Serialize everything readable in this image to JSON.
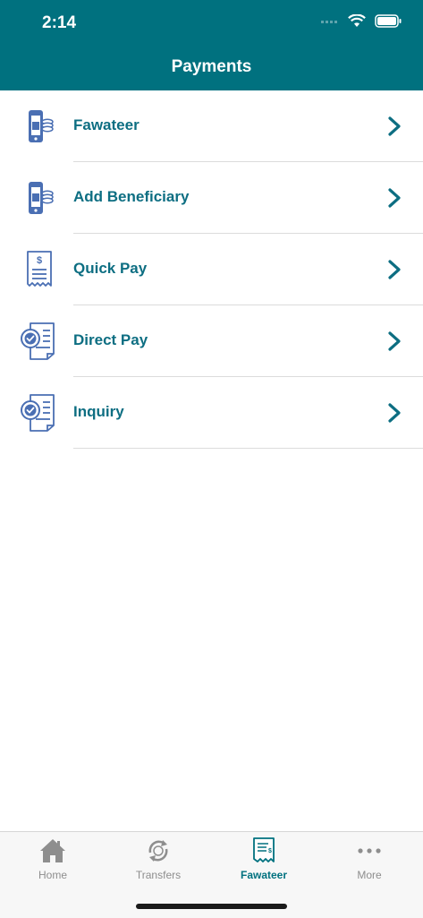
{
  "status": {
    "time": "2:14"
  },
  "header": {
    "title": "Payments"
  },
  "items": [
    {
      "label": "Fawateer",
      "icon": "phone-coins-icon"
    },
    {
      "label": "Add Beneficiary",
      "icon": "phone-coins-icon"
    },
    {
      "label": "Quick Pay",
      "icon": "receipt-dollar-icon"
    },
    {
      "label": "Direct Pay",
      "icon": "document-check-icon"
    },
    {
      "label": "Inquiry",
      "icon": "document-check-icon"
    }
  ],
  "tabs": [
    {
      "label": "Home",
      "icon": "home-icon",
      "active": false
    },
    {
      "label": "Transfers",
      "icon": "transfer-icon",
      "active": false
    },
    {
      "label": "Fawateer",
      "icon": "bill-icon",
      "active": true
    },
    {
      "label": "More",
      "icon": "more-dots-icon",
      "active": false
    }
  ],
  "colors": {
    "accent": "#00717f",
    "text": "#0d6e82",
    "icon": "#4a6fb3"
  }
}
